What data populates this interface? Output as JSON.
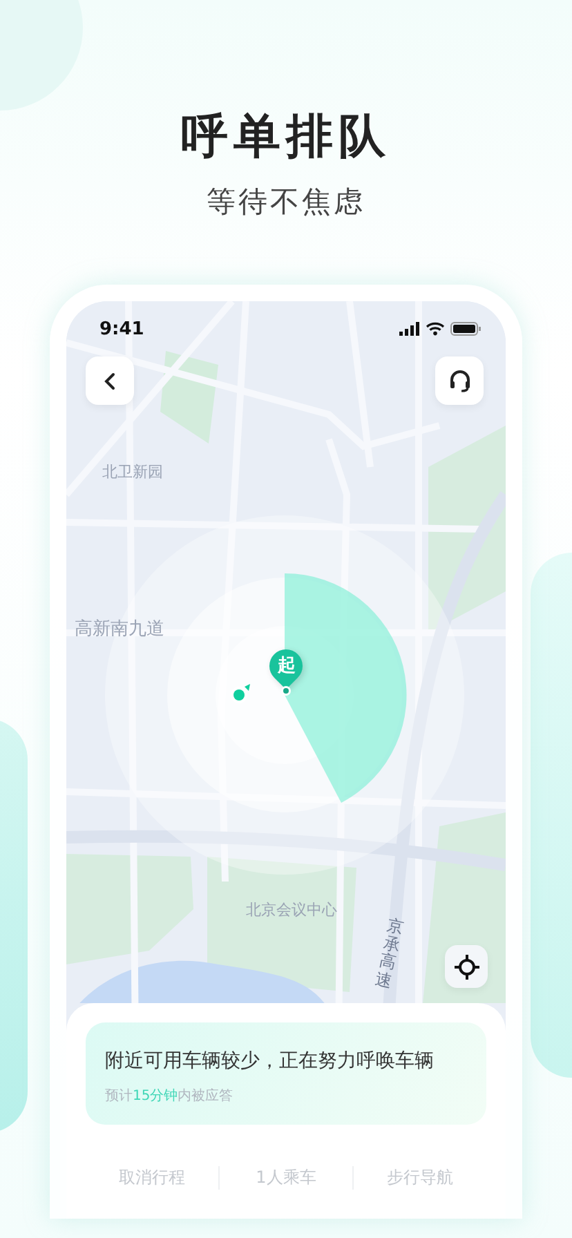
{
  "header": {
    "title": "呼单排队",
    "subtitle": "等待不焦虑"
  },
  "status_bar": {
    "time": "9:41"
  },
  "map": {
    "labels": [
      {
        "text": "北卫新园",
        "kind": "area"
      },
      {
        "text": "高新南九道",
        "kind": "road"
      },
      {
        "text": "北京会议中心",
        "kind": "place"
      },
      {
        "text": "京承高速",
        "kind": "vertical"
      }
    ],
    "pin_label": "起"
  },
  "notice": {
    "message": "附近可用车辆较少，正在努力呼唤车辆",
    "eta": {
      "before": "预计",
      "highlight": "15分钟",
      "after": "内被应答"
    }
  },
  "actions": [
    "取消行程",
    "1人乘车",
    "步行导航"
  ]
}
